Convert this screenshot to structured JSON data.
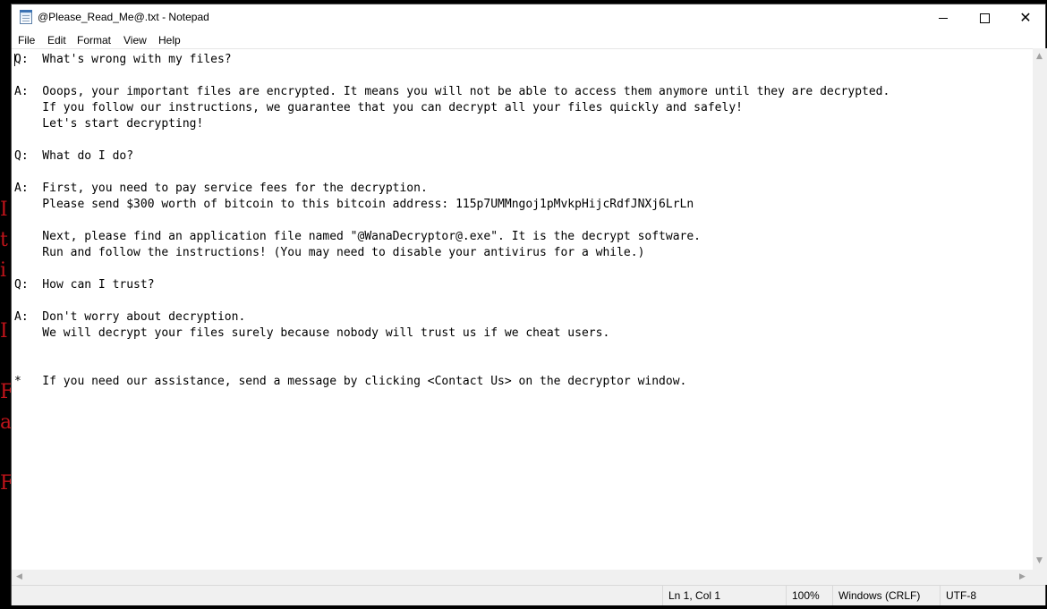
{
  "window": {
    "title": "@Please_Read_Me@.txt - Notepad",
    "controls": {
      "minimize_icon": "minimize-icon",
      "maximize_icon": "maximize-icon",
      "close_icon": "close-icon"
    }
  },
  "menu": {
    "file": "File",
    "edit": "Edit",
    "format": "Format",
    "view": "View",
    "help": "Help"
  },
  "document": {
    "text": "Q:  What's wrong with my files?\n\nA:  Ooops, your important files are encrypted. It means you will not be able to access them anymore until they are decrypted.\n    If you follow our instructions, we guarantee that you can decrypt all your files quickly and safely!\n    Let's start decrypting!\n\nQ:  What do I do?\n\nA:  First, you need to pay service fees for the decryption.\n    Please send $300 worth of bitcoin to this bitcoin address: 115p7UMMngoj1pMvkpHijcRdfJNXj6LrLn\n\n    Next, please find an application file named \"@WanaDecryptor@.exe\". It is the decrypt software.\n    Run and follow the instructions! (You may need to disable your antivirus for a while.)\n\nQ:  How can I trust?\n\nA:  Don't worry about decryption.\n    We will decrypt your files surely because nobody will trust us if we cheat users.\n\n\n*   If you need our assistance, send a message by clicking <Contact Us> on the decryptor window."
  },
  "status": {
    "position": "Ln 1, Col 1",
    "zoom": "100%",
    "line_ending": "Windows (CRLF)",
    "encoding": "UTF-8"
  },
  "background": {
    "fragments": [
      "I",
      "t",
      "i",
      "I",
      "F",
      "a",
      "F"
    ],
    "fragment_color": "#c0141a"
  }
}
